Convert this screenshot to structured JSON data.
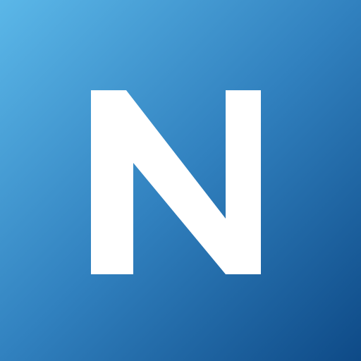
{
  "icon": {
    "name": "n-letter-logo-icon",
    "letter": "N",
    "colors": {
      "gradient_start": "#5bb7e8",
      "gradient_mid": "#3181bf",
      "gradient_end": "#0e4a87",
      "letter": "#ffffff"
    }
  }
}
